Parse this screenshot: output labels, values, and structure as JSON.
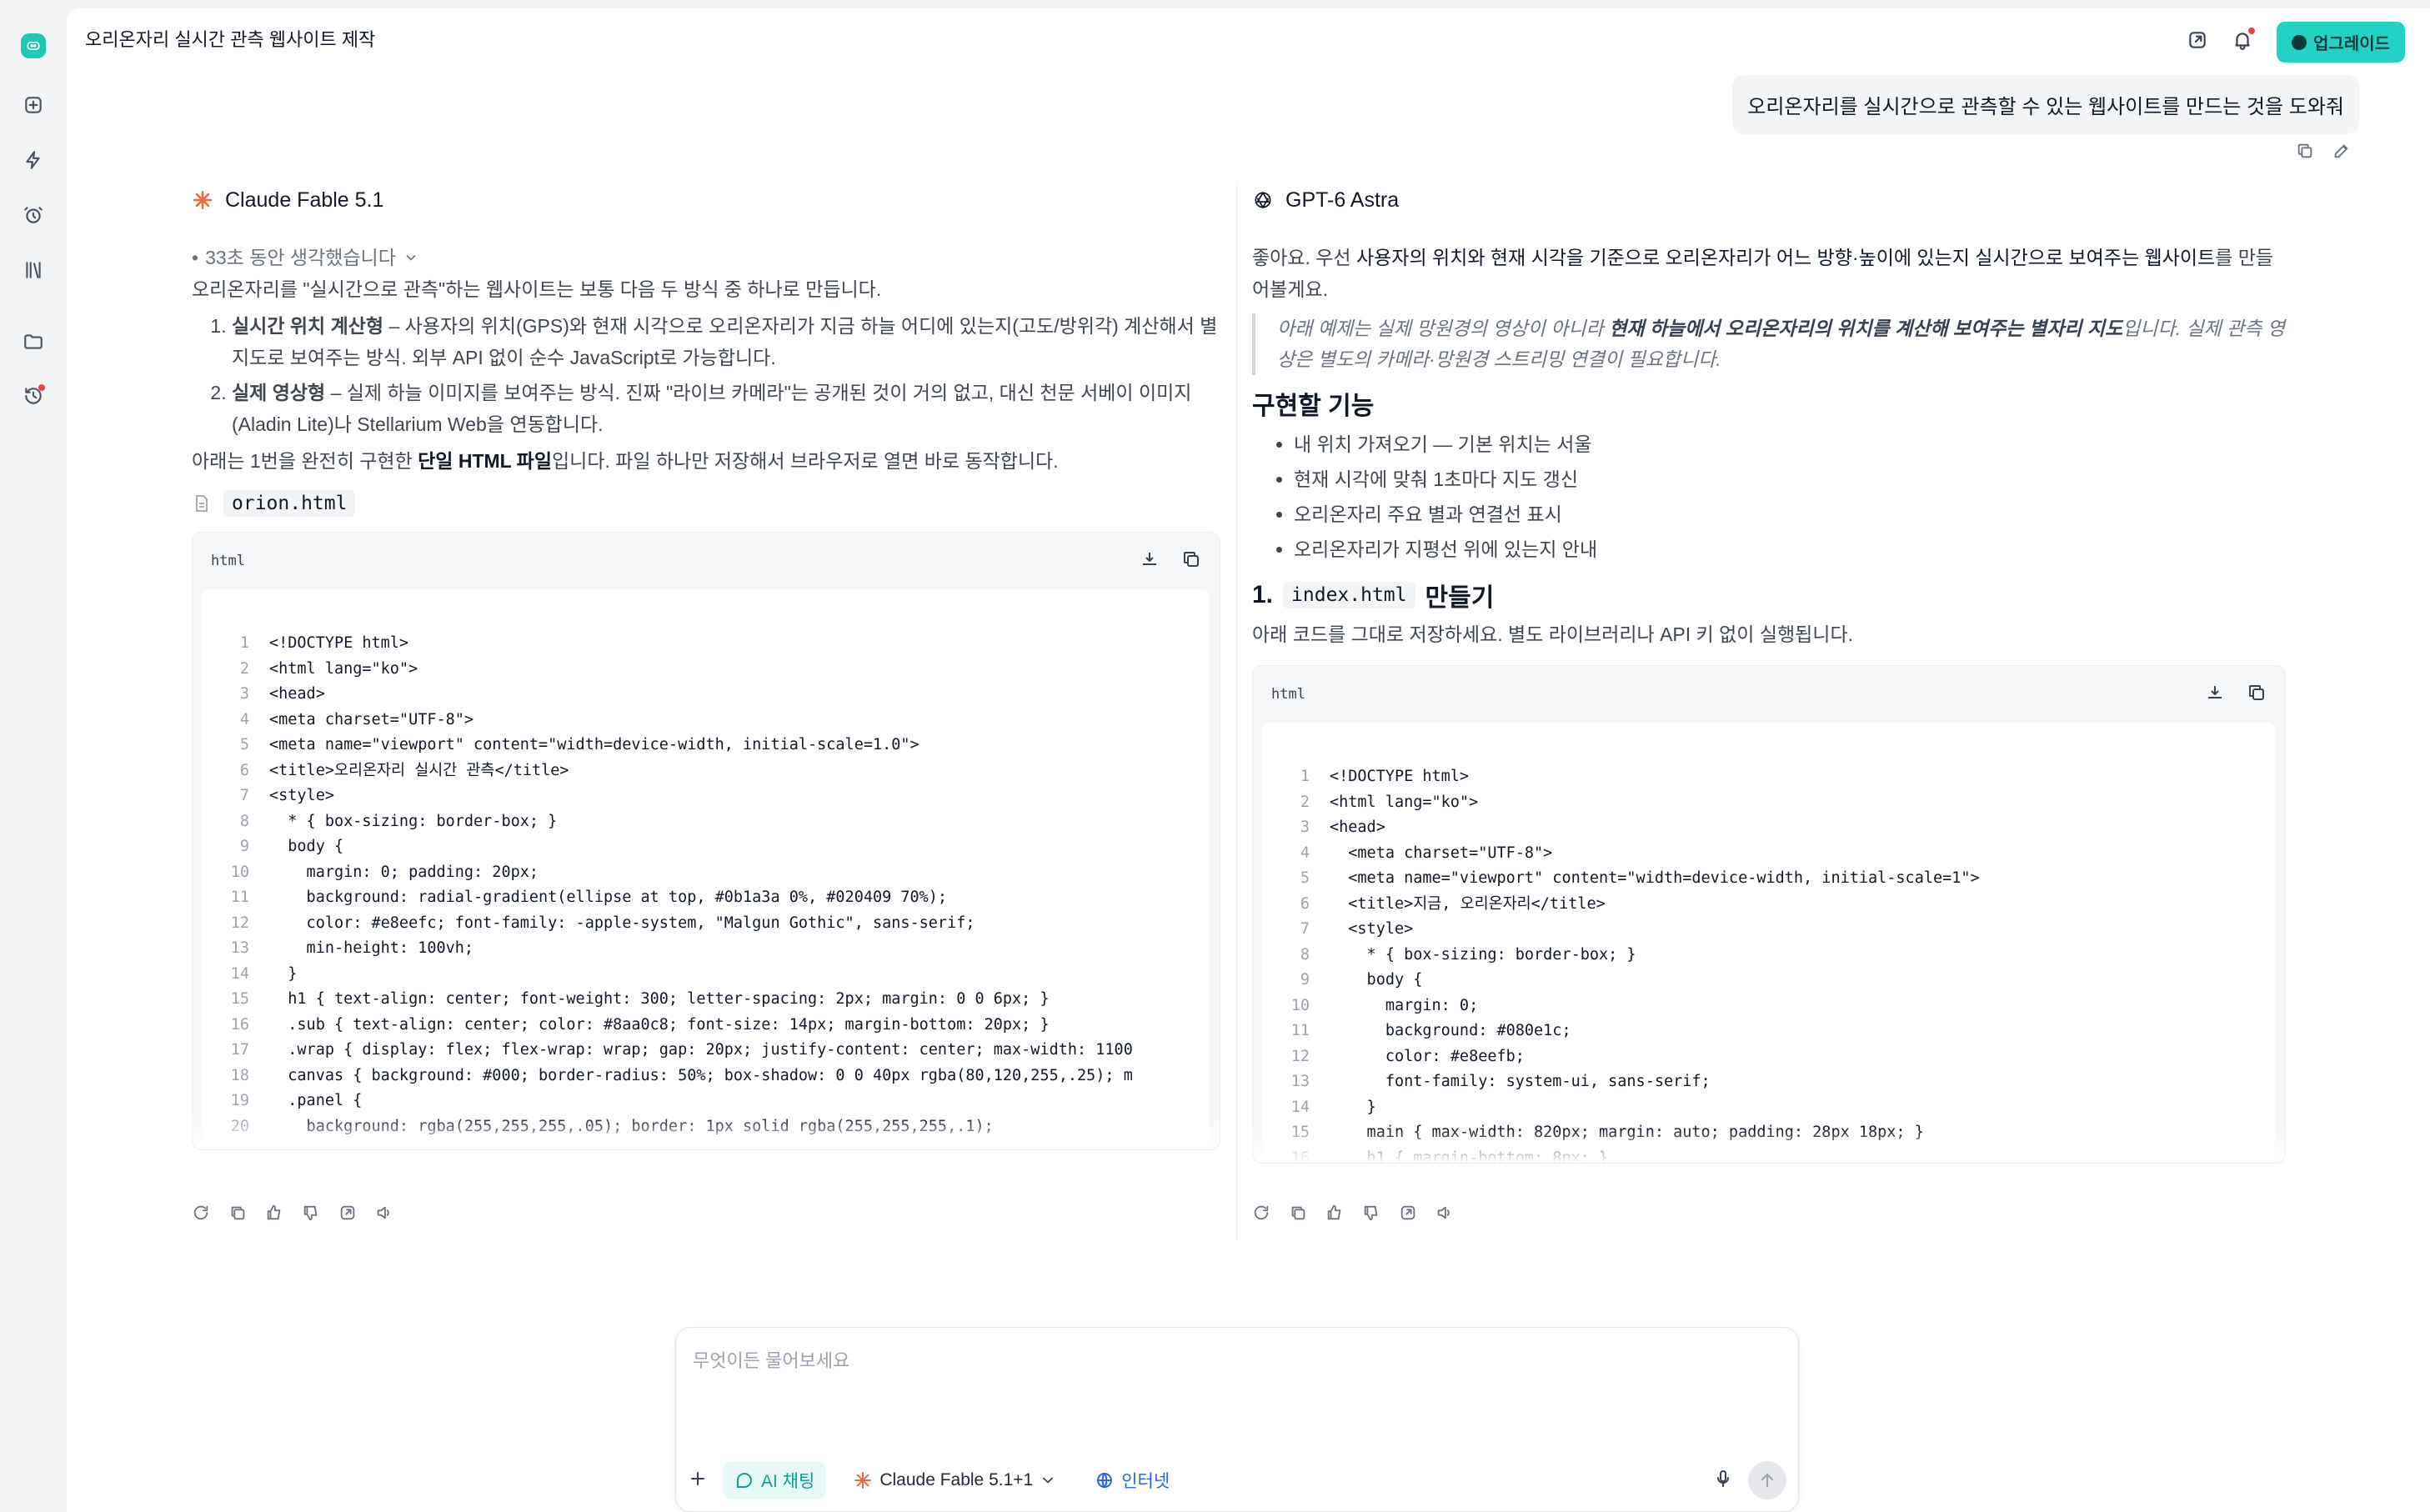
{
  "header": {
    "title": "오리온자리 실시간 관측 웹사이트 제작",
    "upgrade_label": "업그레이드"
  },
  "user_message": "오리온자리를 실시간으로 관측할 수 있는 웹사이트를 만드는 것을 도와줘",
  "left": {
    "model": "Claude Fable 5.1",
    "thinking": "33초 동안 생각했습니다",
    "intro": "오리온자리를 \"실시간으로 관측\"하는 웹사이트는 보통 다음 두 방식 중 하나로 만듭니다.",
    "items": [
      {
        "title": "실시간 위치 계산형",
        "text": " – 사용자의 위치(GPS)와 현재 시각으로 오리온자리가 지금 하늘 어디에 있는지(고도/방위각) 계산해서 별지도로 보여주는 방식. 외부 API 없이 순수 JavaScript로 가능합니다."
      },
      {
        "title": "실제 영상형",
        "text": " – 실제 하늘 이미지를 보여주는 방식. 진짜 \"라이브 카메라\"는 공개된 것이 거의 없고, 대신 천문 서베이 이미지(Aladin Lite)나 Stellarium Web을 연동합니다."
      }
    ],
    "summary_pre": "아래는 1번을 완전히 구현한 ",
    "summary_bold": "단일 HTML 파일",
    "summary_post": "입니다. 파일 하나만 저장해서 브라우저로 열면 바로 동작합니다.",
    "filename": "orion.html",
    "code_lang": "html",
    "code": [
      "<!DOCTYPE html>",
      "<html lang=\"ko\">",
      "<head>",
      "<meta charset=\"UTF-8\">",
      "<meta name=\"viewport\" content=\"width=device-width, initial-scale=1.0\">",
      "<title>오리온자리 실시간 관측</title>",
      "<style>",
      "  * { box-sizing: border-box; }",
      "  body {",
      "    margin: 0; padding: 20px;",
      "    background: radial-gradient(ellipse at top, #0b1a3a 0%, #020409 70%);",
      "    color: #e8eefc; font-family: -apple-system, \"Malgun Gothic\", sans-serif;",
      "    min-height: 100vh;",
      "  }",
      "  h1 { text-align: center; font-weight: 300; letter-spacing: 2px; margin: 0 0 6px; }",
      "  .sub { text-align: center; color: #8aa0c8; font-size: 14px; margin-bottom: 20px; }",
      "  .wrap { display: flex; flex-wrap: wrap; gap: 20px; justify-content: center; max-width: 1100",
      "  canvas { background: #000; border-radius: 50%; box-shadow: 0 0 40px rgba(80,120,255,.25); m",
      "  .panel {",
      "    background: rgba(255,255,255,.05); border: 1px solid rgba(255,255,255,.1);"
    ]
  },
  "right": {
    "model": "GPT-6 Astra",
    "intro_pre": "좋아요. 우선 ",
    "intro_bold": "사용자의 위치와 현재 시각을 기준으로 오리온자리가 어느 방향·높이에 있는지 실시간으로 보여주는 웹사이트",
    "intro_post": "를 만들어볼게요.",
    "quote_pre": "아래 예제는 실제 망원경의 영상이 아니라 ",
    "quote_bold": "현재 하늘에서 오리온자리의 위치를 계산해 보여주는 별자리 지도",
    "quote_post": "입니다. 실제 관측 영상은 별도의 카메라·망원경 스트리밍 연결이 필요합니다.",
    "features_title": "구현할 기능",
    "features": [
      "내 위치 가져오기 — 기본 위치는 서울",
      "현재 시각에 맞춰 1초마다 지도 갱신",
      "오리온자리 주요 별과 연결선 표시",
      "오리온자리가 지평선 위에 있는지 안내"
    ],
    "step_num": "1.",
    "step_code": "index.html",
    "step_title": "만들기",
    "step_text": "아래 코드를 그대로 저장하세요. 별도 라이브러리나 API 키 없이 실행됩니다.",
    "code_lang": "html",
    "code": [
      "<!DOCTYPE html>",
      "<html lang=\"ko\">",
      "<head>",
      "  <meta charset=\"UTF-8\">",
      "  <meta name=\"viewport\" content=\"width=device-width, initial-scale=1\">",
      "  <title>지금, 오리온자리</title>",
      "  <style>",
      "    * { box-sizing: border-box; }",
      "    body {",
      "      margin: 0;",
      "      background: #080e1c;",
      "      color: #e8eefb;",
      "      font-family: system-ui, sans-serif;",
      "    }",
      "    main { max-width: 820px; margin: auto; padding: 28px 18px; }",
      "    h1 { margin-bottom: 8px; }"
    ]
  },
  "composer": {
    "placeholder": "무엇이든 물어보세요",
    "ai_chip": "AI 채팅",
    "model_chip": "Claude Fable 5.1+1",
    "web_chip": "인터넷"
  }
}
